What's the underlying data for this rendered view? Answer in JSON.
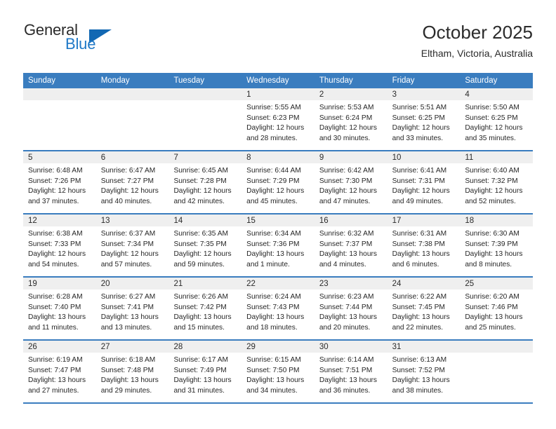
{
  "brand": {
    "word_general": "General",
    "word_blue": "Blue",
    "triangle_color": "#1268b3",
    "blue_text_color": "#2079c7"
  },
  "header": {
    "title": "October 2025",
    "location": "Eltham, Victoria, Australia"
  },
  "theme": {
    "header_row_bg": "#3a7dbf",
    "header_row_text": "#ffffff",
    "day_number_bg": "#efefef",
    "cell_bg": "#ffffff",
    "row_divider": "#3a7dbf"
  },
  "weekdays": [
    "Sunday",
    "Monday",
    "Tuesday",
    "Wednesday",
    "Thursday",
    "Friday",
    "Saturday"
  ],
  "labels": {
    "sunrise_prefix": "Sunrise:",
    "sunset_prefix": "Sunset:",
    "daylight_prefix": "Daylight:"
  },
  "weeks": [
    [
      {
        "day": "",
        "empty": true
      },
      {
        "day": "",
        "empty": true
      },
      {
        "day": "",
        "empty": true
      },
      {
        "day": "1",
        "sunrise": "Sunrise: 5:55 AM",
        "sunset": "Sunset: 6:23 PM",
        "daylight1": "Daylight: 12 hours",
        "daylight2": "and 28 minutes."
      },
      {
        "day": "2",
        "sunrise": "Sunrise: 5:53 AM",
        "sunset": "Sunset: 6:24 PM",
        "daylight1": "Daylight: 12 hours",
        "daylight2": "and 30 minutes."
      },
      {
        "day": "3",
        "sunrise": "Sunrise: 5:51 AM",
        "sunset": "Sunset: 6:25 PM",
        "daylight1": "Daylight: 12 hours",
        "daylight2": "and 33 minutes."
      },
      {
        "day": "4",
        "sunrise": "Sunrise: 5:50 AM",
        "sunset": "Sunset: 6:25 PM",
        "daylight1": "Daylight: 12 hours",
        "daylight2": "and 35 minutes."
      }
    ],
    [
      {
        "day": "5",
        "sunrise": "Sunrise: 6:48 AM",
        "sunset": "Sunset: 7:26 PM",
        "daylight1": "Daylight: 12 hours",
        "daylight2": "and 37 minutes."
      },
      {
        "day": "6",
        "sunrise": "Sunrise: 6:47 AM",
        "sunset": "Sunset: 7:27 PM",
        "daylight1": "Daylight: 12 hours",
        "daylight2": "and 40 minutes."
      },
      {
        "day": "7",
        "sunrise": "Sunrise: 6:45 AM",
        "sunset": "Sunset: 7:28 PM",
        "daylight1": "Daylight: 12 hours",
        "daylight2": "and 42 minutes."
      },
      {
        "day": "8",
        "sunrise": "Sunrise: 6:44 AM",
        "sunset": "Sunset: 7:29 PM",
        "daylight1": "Daylight: 12 hours",
        "daylight2": "and 45 minutes."
      },
      {
        "day": "9",
        "sunrise": "Sunrise: 6:42 AM",
        "sunset": "Sunset: 7:30 PM",
        "daylight1": "Daylight: 12 hours",
        "daylight2": "and 47 minutes."
      },
      {
        "day": "10",
        "sunrise": "Sunrise: 6:41 AM",
        "sunset": "Sunset: 7:31 PM",
        "daylight1": "Daylight: 12 hours",
        "daylight2": "and 49 minutes."
      },
      {
        "day": "11",
        "sunrise": "Sunrise: 6:40 AM",
        "sunset": "Sunset: 7:32 PM",
        "daylight1": "Daylight: 12 hours",
        "daylight2": "and 52 minutes."
      }
    ],
    [
      {
        "day": "12",
        "sunrise": "Sunrise: 6:38 AM",
        "sunset": "Sunset: 7:33 PM",
        "daylight1": "Daylight: 12 hours",
        "daylight2": "and 54 minutes."
      },
      {
        "day": "13",
        "sunrise": "Sunrise: 6:37 AM",
        "sunset": "Sunset: 7:34 PM",
        "daylight1": "Daylight: 12 hours",
        "daylight2": "and 57 minutes."
      },
      {
        "day": "14",
        "sunrise": "Sunrise: 6:35 AM",
        "sunset": "Sunset: 7:35 PM",
        "daylight1": "Daylight: 12 hours",
        "daylight2": "and 59 minutes."
      },
      {
        "day": "15",
        "sunrise": "Sunrise: 6:34 AM",
        "sunset": "Sunset: 7:36 PM",
        "daylight1": "Daylight: 13 hours",
        "daylight2": "and 1 minute."
      },
      {
        "day": "16",
        "sunrise": "Sunrise: 6:32 AM",
        "sunset": "Sunset: 7:37 PM",
        "daylight1": "Daylight: 13 hours",
        "daylight2": "and 4 minutes."
      },
      {
        "day": "17",
        "sunrise": "Sunrise: 6:31 AM",
        "sunset": "Sunset: 7:38 PM",
        "daylight1": "Daylight: 13 hours",
        "daylight2": "and 6 minutes."
      },
      {
        "day": "18",
        "sunrise": "Sunrise: 6:30 AM",
        "sunset": "Sunset: 7:39 PM",
        "daylight1": "Daylight: 13 hours",
        "daylight2": "and 8 minutes."
      }
    ],
    [
      {
        "day": "19",
        "sunrise": "Sunrise: 6:28 AM",
        "sunset": "Sunset: 7:40 PM",
        "daylight1": "Daylight: 13 hours",
        "daylight2": "and 11 minutes."
      },
      {
        "day": "20",
        "sunrise": "Sunrise: 6:27 AM",
        "sunset": "Sunset: 7:41 PM",
        "daylight1": "Daylight: 13 hours",
        "daylight2": "and 13 minutes."
      },
      {
        "day": "21",
        "sunrise": "Sunrise: 6:26 AM",
        "sunset": "Sunset: 7:42 PM",
        "daylight1": "Daylight: 13 hours",
        "daylight2": "and 15 minutes."
      },
      {
        "day": "22",
        "sunrise": "Sunrise: 6:24 AM",
        "sunset": "Sunset: 7:43 PM",
        "daylight1": "Daylight: 13 hours",
        "daylight2": "and 18 minutes."
      },
      {
        "day": "23",
        "sunrise": "Sunrise: 6:23 AM",
        "sunset": "Sunset: 7:44 PM",
        "daylight1": "Daylight: 13 hours",
        "daylight2": "and 20 minutes."
      },
      {
        "day": "24",
        "sunrise": "Sunrise: 6:22 AM",
        "sunset": "Sunset: 7:45 PM",
        "daylight1": "Daylight: 13 hours",
        "daylight2": "and 22 minutes."
      },
      {
        "day": "25",
        "sunrise": "Sunrise: 6:20 AM",
        "sunset": "Sunset: 7:46 PM",
        "daylight1": "Daylight: 13 hours",
        "daylight2": "and 25 minutes."
      }
    ],
    [
      {
        "day": "26",
        "sunrise": "Sunrise: 6:19 AM",
        "sunset": "Sunset: 7:47 PM",
        "daylight1": "Daylight: 13 hours",
        "daylight2": "and 27 minutes."
      },
      {
        "day": "27",
        "sunrise": "Sunrise: 6:18 AM",
        "sunset": "Sunset: 7:48 PM",
        "daylight1": "Daylight: 13 hours",
        "daylight2": "and 29 minutes."
      },
      {
        "day": "28",
        "sunrise": "Sunrise: 6:17 AM",
        "sunset": "Sunset: 7:49 PM",
        "daylight1": "Daylight: 13 hours",
        "daylight2": "and 31 minutes."
      },
      {
        "day": "29",
        "sunrise": "Sunrise: 6:15 AM",
        "sunset": "Sunset: 7:50 PM",
        "daylight1": "Daylight: 13 hours",
        "daylight2": "and 34 minutes."
      },
      {
        "day": "30",
        "sunrise": "Sunrise: 6:14 AM",
        "sunset": "Sunset: 7:51 PM",
        "daylight1": "Daylight: 13 hours",
        "daylight2": "and 36 minutes."
      },
      {
        "day": "31",
        "sunrise": "Sunrise: 6:13 AM",
        "sunset": "Sunset: 7:52 PM",
        "daylight1": "Daylight: 13 hours",
        "daylight2": "and 38 minutes."
      },
      {
        "day": "",
        "empty": true
      }
    ]
  ]
}
